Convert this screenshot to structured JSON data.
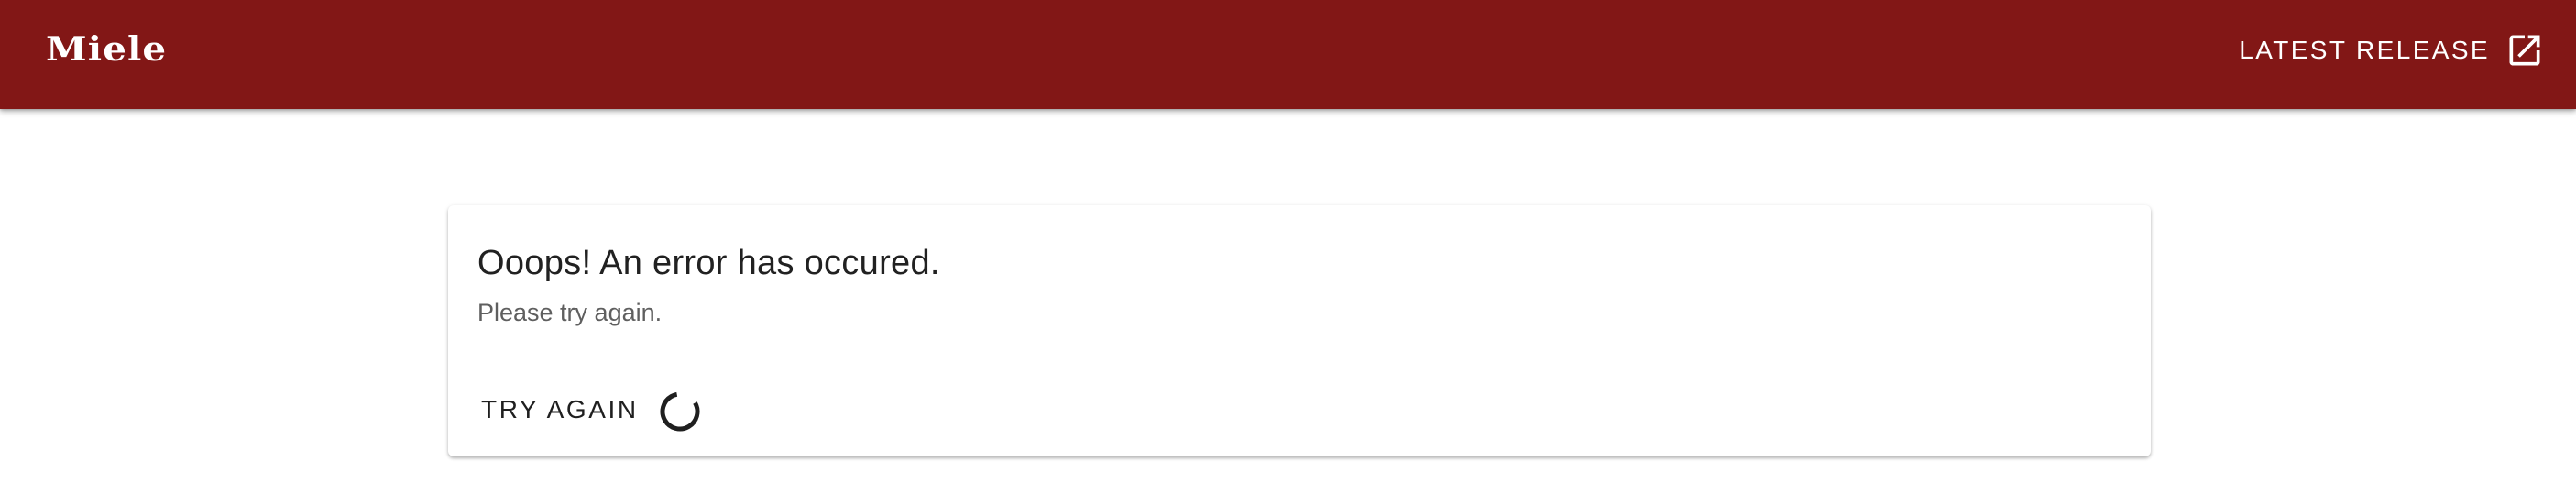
{
  "brand": {
    "logo_text": "Miele",
    "color": "#821716"
  },
  "header": {
    "release_link_label": "LATEST RELEASE",
    "release_link_icon": "open-in-new-icon"
  },
  "error_card": {
    "title": "Ooops! An error has occured.",
    "subtitle": "Please try again.",
    "retry_button_label": "TRY AGAIN",
    "spinner_icon": "loading-spinner-icon"
  }
}
